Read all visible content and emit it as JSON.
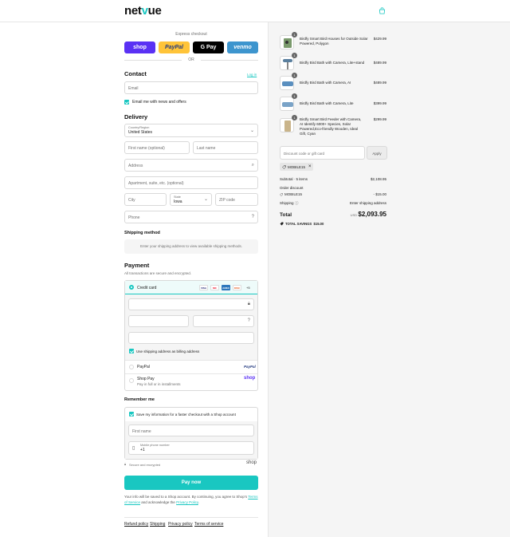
{
  "header": {
    "logo_prefix": "net",
    "logo_v": "v",
    "logo_suffix": "ue"
  },
  "express": {
    "label": "Express checkout",
    "buttons": [
      {
        "label": "shop",
        "bg": "#5a31f4",
        "color": "#ffffff"
      },
      {
        "label": "PayPal",
        "bg": "#ffc439",
        "color": "#253b80"
      },
      {
        "label": "G Pay",
        "bg": "#000000",
        "color": "#ffffff"
      },
      {
        "label": "venmo",
        "bg": "#3d95ce",
        "color": "#ffffff"
      }
    ],
    "or": "OR"
  },
  "contact": {
    "title": "Contact",
    "login": "Log in",
    "email_placeholder": "Email",
    "news_label": "Email me with news and offers"
  },
  "delivery": {
    "title": "Delivery",
    "country_label": "Country/Region",
    "country_value": "United States",
    "first_name": "First name (optional)",
    "last_name": "Last name",
    "address": "Address",
    "apartment": "Apartment, suite, etc. (optional)",
    "city": "City",
    "state_label": "State",
    "state_value": "Iowa",
    "zip": "ZIP code",
    "phone": "Phone"
  },
  "shipping": {
    "title": "Shipping method",
    "message": "Enter your shipping address to view available shipping methods."
  },
  "payment": {
    "title": "Payment",
    "subtitle": "All transactions are secure and encrypted.",
    "credit_card": "Credit card",
    "card_logos": [
      "VISA",
      "MC",
      "AMEX",
      "DISC"
    ],
    "more_cards": "+5",
    "billing_label": "Use shipping address as billing address",
    "paypal": "PayPal",
    "paypal_logo": "PayPal",
    "shop_pay": "Shop Pay",
    "shop_pay_sub": "Pay in full or in installments",
    "shop_pay_logo": "shop"
  },
  "remember": {
    "title": "Remember me",
    "save_label": "Save my information for a faster checkout with a Shop account",
    "first_name": "First name",
    "mobile_label": "Mobile phone number",
    "mobile_value": "+1",
    "secure": "Secure and encrypted",
    "shop_logo": "shop"
  },
  "pay_now": "Pay now",
  "legal": {
    "text": "Your info will be saved to a Shop account. By continuing, you agree to Shop’s",
    "tos": "Terms of Service",
    "and": "and acknowledge the",
    "privacy": "Privacy Policy",
    "period": "."
  },
  "footer_links": [
    "Refund policy",
    "Shipping",
    "Privacy policy",
    "Terms of service"
  ],
  "cart": {
    "items": [
      {
        "qty": "1",
        "name": "Birdfy Smart Bird Houses for Outside Solar Powered, Polygon",
        "price": "$429.99"
      },
      {
        "qty": "1",
        "name": "Birdfy Bird Bath with Camera, Lite+stand",
        "price": "$489.99"
      },
      {
        "qty": "1",
        "name": "Birdfy Bird Bath with Camera, AI",
        "price": "$489.99"
      },
      {
        "qty": "1",
        "name": "Birdfy Bird Bath with Camera, Lite",
        "price": "$399.99"
      },
      {
        "qty": "1",
        "name": "Birdfy Smart Bird Feeder with Camera, AI Identify 6000+ Species, Solar Powered,Eco-friendly Wooden, Ideal Gift, Cyan",
        "price": "$299.99"
      }
    ],
    "discount_placeholder": "Discount code or gift card",
    "apply": "Apply",
    "code_tag": "MOBILE15",
    "subtotal_label": "Subtotal · 5 items",
    "subtotal_value": "$2,108.95",
    "order_discount_label": "Order discount",
    "code_label": "MOBILE15",
    "code_value": "- $15.00",
    "shipping_label": "Shipping",
    "shipping_value": "Enter shipping address",
    "total_label": "Total",
    "currency": "USD",
    "total_value": "$2,093.95",
    "savings_label": "TOTAL SAVINGS",
    "savings_value": "$15.00"
  },
  "colors": {
    "accent": "#19c7c1",
    "panel": "#f5f5f5"
  }
}
